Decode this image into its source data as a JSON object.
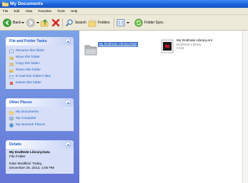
{
  "window": {
    "title": "My Documents"
  },
  "menu": [
    "File",
    "Edit",
    "View",
    "Favorites",
    "Tools",
    "Help"
  ],
  "toolbar": {
    "back": "Back",
    "search": "Search",
    "folders": "Folders",
    "folder_sync": "Folder Sync"
  },
  "file_tasks": {
    "title": "File and Folder Tasks",
    "items": [
      "Rename this folder",
      "Move this folder",
      "Copy this folder",
      "Share this folder",
      "E-mail this folder's files",
      "Delete this folder"
    ]
  },
  "other_places": {
    "title": "Other Places",
    "items": [
      "My Documents",
      "My Computer",
      "My Network Places"
    ]
  },
  "details": {
    "title": "Details",
    "name": "My EndNote Library.Data",
    "type": "File Folder",
    "modified_line1": "Date Modified: Today,",
    "modified_line2": "December 20, 2013, 1:06 PM"
  },
  "files": {
    "folder_name": "My EndNote Library.Data",
    "lib_name": "My EndNote Library.enl",
    "lib_type": "EndNote Library",
    "lib_size": "0 KB"
  },
  "colors": {
    "accent": "#316ac5",
    "taskpane": "#6375d6",
    "link": "#215dc6"
  }
}
